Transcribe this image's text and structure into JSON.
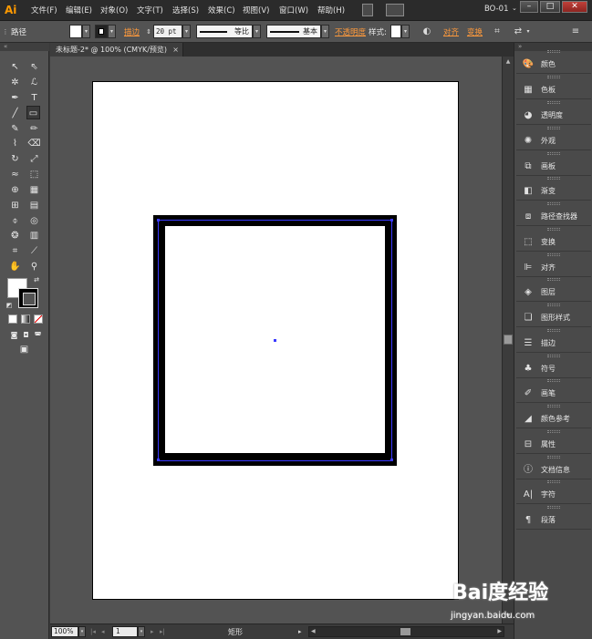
{
  "app": {
    "logo": "Ai",
    "workspace": "BO-01"
  },
  "menu": [
    {
      "label": "文件(F)"
    },
    {
      "label": "编辑(E)"
    },
    {
      "label": "对象(O)"
    },
    {
      "label": "文字(T)"
    },
    {
      "label": "选择(S)"
    },
    {
      "label": "效果(C)"
    },
    {
      "label": "视图(V)"
    },
    {
      "label": "窗口(W)"
    },
    {
      "label": "帮助(H)"
    }
  ],
  "window_controls": {
    "minimize": "–",
    "maximize": "□",
    "close": "✕"
  },
  "control_bar": {
    "object_type": "路径",
    "stroke_link": "描边",
    "stroke_weight": "20 pt",
    "stroke_profile": "等比",
    "brush": "基本",
    "opacity_link": "不透明度",
    "style_label": "样式:",
    "align_link": "对齐",
    "transform_link": "变换"
  },
  "document": {
    "tab_title": "未标题-2* @ 100% (CMYK/预览)",
    "close": "×"
  },
  "status_bar": {
    "zoom": "100%",
    "page": "1",
    "status": "矩形"
  },
  "panels": [
    {
      "label": "颜色",
      "icon": "color-icon"
    },
    {
      "label": "色板",
      "icon": "swatches-icon"
    },
    {
      "label": "透明度",
      "icon": "transparency-icon"
    },
    {
      "label": "外观",
      "icon": "appearance-icon"
    },
    {
      "label": "画板",
      "icon": "artboards-icon"
    },
    {
      "label": "渐变",
      "icon": "gradient-icon"
    },
    {
      "label": "路径查找器",
      "icon": "pathfinder-icon"
    },
    {
      "label": "变换",
      "icon": "transform-icon"
    },
    {
      "label": "对齐",
      "icon": "align-icon"
    },
    {
      "label": "图层",
      "icon": "layers-icon"
    },
    {
      "label": "图形样式",
      "icon": "graphic-styles-icon"
    },
    {
      "label": "描边",
      "icon": "stroke-icon"
    },
    {
      "label": "符号",
      "icon": "symbols-icon"
    },
    {
      "label": "画笔",
      "icon": "brushes-icon"
    },
    {
      "label": "颜色参考",
      "icon": "color-guide-icon"
    },
    {
      "label": "属性",
      "icon": "attributes-icon"
    },
    {
      "label": "文档信息",
      "icon": "document-info-icon"
    },
    {
      "label": "字符",
      "icon": "character-icon"
    },
    {
      "label": "段落",
      "icon": "paragraph-icon"
    }
  ],
  "colors": {
    "accent_orange": "#ff9a00",
    "selection_blue": "#3a3aff",
    "fill": "#ffffff",
    "stroke": "#000000"
  },
  "watermark": {
    "brand": "Bai度经验",
    "url": "jingyan.baidu.com"
  }
}
